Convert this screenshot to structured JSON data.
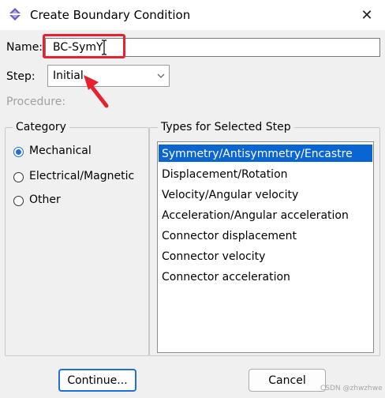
{
  "window": {
    "title": "Create Boundary Condition",
    "icon": "diamond-app-icon",
    "close_label": "✕"
  },
  "name_field": {
    "label": "Name:",
    "value": "BC-SymY"
  },
  "step_field": {
    "label": "Step:",
    "value": "Initial",
    "dropdown_icon": "chevron-down-icon"
  },
  "procedure_label": "Procedure:",
  "category": {
    "title": "Category",
    "options": [
      {
        "label": "Mechanical",
        "selected": true
      },
      {
        "label": "Electrical/Magnetic",
        "selected": false
      },
      {
        "label": "Other",
        "selected": false
      }
    ]
  },
  "types": {
    "title": "Types for Selected Step",
    "items": [
      "Symmetry/Antisymmetry/Encastre",
      "Displacement/Rotation",
      "Velocity/Angular velocity",
      "Acceleration/Angular acceleration",
      "Connector displacement",
      "Connector velocity",
      "Connector acceleration"
    ],
    "selected_index": 0
  },
  "buttons": {
    "continue": "Continue...",
    "cancel": "Cancel"
  },
  "watermark": "CSDN @zhwzhwe",
  "colors": {
    "highlight_red": "#e8212f",
    "selection_blue": "#0a64d2",
    "radio_blue": "#1f6fd6"
  }
}
